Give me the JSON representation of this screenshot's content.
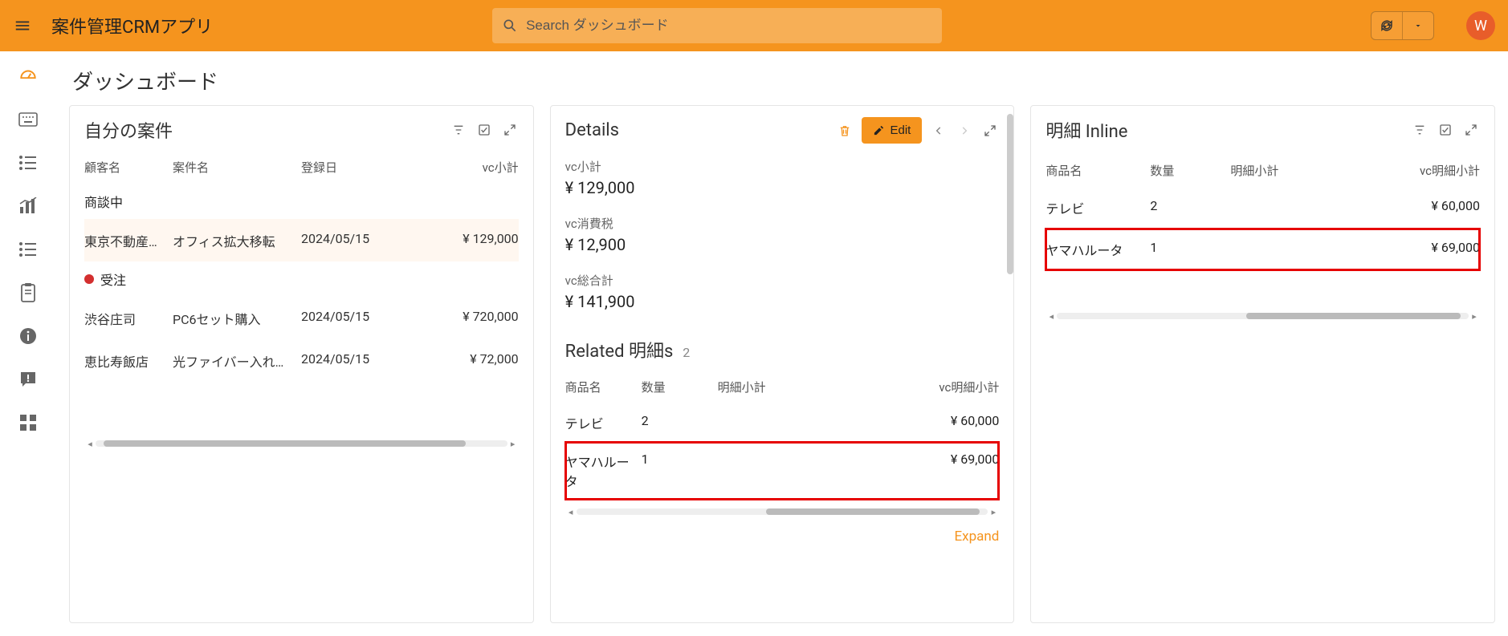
{
  "header": {
    "app_title": "案件管理CRMアプリ",
    "search_placeholder": "Search ダッシュボード",
    "avatar_initial": "W"
  },
  "page": {
    "title": "ダッシュボード"
  },
  "panel1": {
    "title": "自分の案件",
    "columns": {
      "customer": "顧客名",
      "case": "案件名",
      "regdate": "登録日",
      "subtotal": "vc小計"
    },
    "groups": [
      {
        "status": "商談中",
        "has_dot": false,
        "rows": [
          {
            "customer": "東京不動産…",
            "case": "オフィス拡大移転",
            "regdate": "2024/05/15",
            "subtotal": "¥ 129,000",
            "highlight": true
          }
        ]
      },
      {
        "status": "受注",
        "has_dot": true,
        "rows": [
          {
            "customer": "渋谷庄司",
            "case": "PC6セット購入",
            "regdate": "2024/05/15",
            "subtotal": "¥ 720,000",
            "highlight": false
          },
          {
            "customer": "恵比寿飯店",
            "case": "光ファイバー入れ…",
            "regdate": "2024/05/15",
            "subtotal": "¥ 72,000",
            "highlight": false
          }
        ]
      }
    ]
  },
  "panel2": {
    "title": "Details",
    "edit_label": "Edit",
    "kv": [
      {
        "label": "vc小計",
        "value": "¥ 129,000"
      },
      {
        "label": "vc消費税",
        "value": "¥ 12,900"
      },
      {
        "label": "vc総合計",
        "value": "¥ 141,900"
      }
    ],
    "related": {
      "title": "Related 明細s",
      "count": "2",
      "columns": {
        "name": "商品名",
        "qty": "数量",
        "sub": "明細小計",
        "vc": "vc明細小計"
      },
      "rows": [
        {
          "name": "テレビ",
          "qty": "2",
          "sub": "",
          "vc": "¥ 60,000",
          "boxed": false
        },
        {
          "name": "ヤマハルータ",
          "qty": "1",
          "sub": "",
          "vc": "¥ 69,000",
          "boxed": true
        }
      ],
      "expand": "Expand"
    }
  },
  "panel3": {
    "title": "明細 Inline",
    "columns": {
      "name": "商品名",
      "qty": "数量",
      "sub": "明細小計",
      "vc": "vc明細小計"
    },
    "rows": [
      {
        "name": "テレビ",
        "qty": "2",
        "sub": "",
        "vc": "¥ 60,000",
        "boxed": false
      },
      {
        "name": "ヤマハルータ",
        "qty": "1",
        "sub": "",
        "vc": "¥ 69,000",
        "boxed": true
      }
    ]
  }
}
